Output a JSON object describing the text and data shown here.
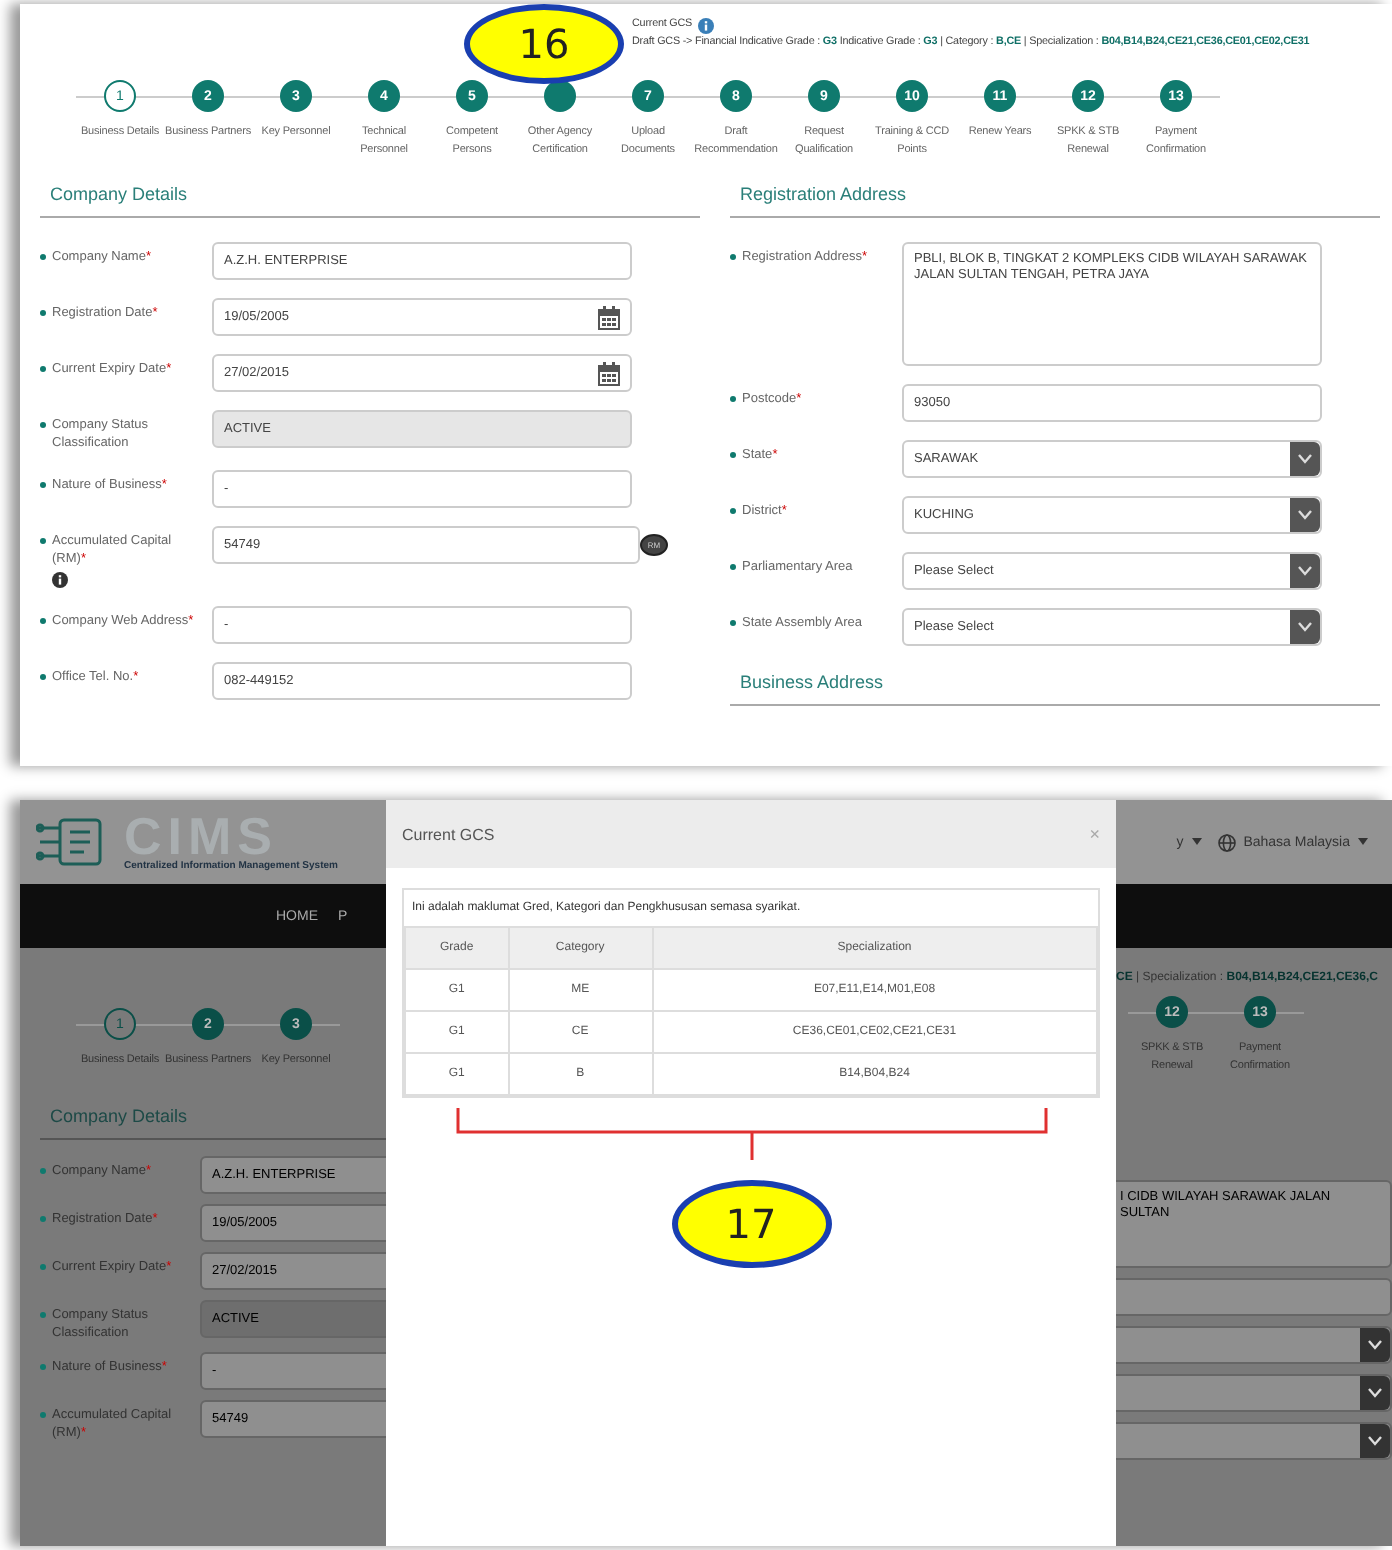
{
  "screen_1": {
    "gcs": {
      "title": "Current GCS",
      "draft_line": "Draft GCS -> Financial Indicative Grade : **G3**  Indicative Grade : **G3** | Category : **B,CE** | Specialization : **B04,B14,B24,CE21,CE36,CE01,CE02,CE31**"
    },
    "callout": "16",
    "steps": [
      {
        "number": "1",
        "label": "Business Details",
        "selected": true
      },
      {
        "number": "2",
        "label": "Business Partners",
        "selected": false
      },
      {
        "number": "3",
        "label": "Key Personnel",
        "selected": false
      },
      {
        "number": "4",
        "label": "Technical Personnel",
        "selected": false
      },
      {
        "number": "5",
        "label": "Competent Persons",
        "selected": false
      },
      {
        "label": "Other Agency Certification",
        "selected": false
      },
      {
        "number": "7",
        "label": "Upload Documents",
        "selected": false
      },
      {
        "number": "8",
        "label": "Draft Recommendation",
        "selected": false
      },
      {
        "number": "9",
        "label": "Request Qualification",
        "selected": false
      },
      {
        "number": "10",
        "label": "Training & CCD Points",
        "selected": false
      },
      {
        "number": "11",
        "label": "Renew Years",
        "selected": false
      },
      {
        "number": "12",
        "label": "SPKK & STB Renewal",
        "selected": false
      },
      {
        "number": "13",
        "label": "Payment Confirmation",
        "selected": false
      }
    ],
    "company_details": {
      "heading": "Company Details",
      "fields": [
        {
          "kind": "text",
          "label": "Company Name",
          "mark": "*",
          "value": "A.Z.H. ENTERPRISE"
        },
        {
          "kind": "date",
          "label": "Registration Date",
          "mark": "*",
          "value": "19/05/2005"
        },
        {
          "kind": "date",
          "label": "Current Expiry Date",
          "mark": "*",
          "value": "27/02/2015"
        },
        {
          "kind": "readonly",
          "label": "Company Status Classification",
          "value": "ACTIVE"
        },
        {
          "kind": "text",
          "label": "Nature of Business",
          "mark": "*",
          "value": "-"
        },
        {
          "kind": "currency",
          "label": "Accumulated Capital (RM)",
          "mark": "*",
          "value": "54749",
          "unit": "RM"
        },
        {
          "kind": "text",
          "label": "Company Web Address",
          "mark": "*",
          "value": "-"
        },
        {
          "kind": "text",
          "label": "Office Tel. No.",
          "mark": "*",
          "value": "082-449152"
        }
      ]
    },
    "registration_address": {
      "heading": "Registration Address",
      "fields": [
        {
          "kind": "textarea",
          "label": "Registration Address",
          "mark": "*",
          "value": "PBLI, BLOK B, TINGKAT 2 KOMPLEKS CIDB WILAYAH SARAWAK JALAN SULTAN TENGAH, PETRA JAYA"
        },
        {
          "kind": "text",
          "label": "Postcode",
          "mark": "*",
          "value": "93050"
        },
        {
          "kind": "select",
          "label": "State",
          "mark": "*",
          "value": "SARAWAK"
        },
        {
          "kind": "select",
          "label": "District",
          "mark": "*",
          "value": "KUCHING"
        },
        {
          "kind": "select",
          "label": "Parliamentary Area",
          "value": "Please Select"
        },
        {
          "kind": "select",
          "label": "State Assembly Area",
          "value": "Please Select"
        }
      ]
    },
    "business_address_heading": "Business Address"
  },
  "screen_2": {
    "header": {
      "brand": "CIMS",
      "subtitle": "Centralized Information Management System",
      "menu_fragment": "y",
      "language": "Bahasa Malaysia"
    },
    "nav": [
      "HOME",
      "P"
    ],
    "gcs_fragment": "**CE** | Specialization : **B04,B14,B24,CE21,CE36,C**",
    "steps_left": [
      {
        "number": "1",
        "label": "Business Details",
        "selected": true
      },
      {
        "number": "2",
        "label": "Business Partners",
        "selected": false
      },
      {
        "number": "3",
        "label": "Key Personnel",
        "selected": false
      }
    ],
    "steps_right": [
      {
        "number": "12",
        "label": "SPKK & STB Renewal",
        "selected": false
      },
      {
        "number": "13",
        "label": "Payment Confirmation",
        "selected": false
      }
    ],
    "company_details": {
      "heading": "Company Details",
      "fields": [
        {
          "kind": "text",
          "label": "Company Name",
          "mark": "*",
          "value": "A.Z.H. ENTERPRISE"
        },
        {
          "kind": "text",
          "label": "Registration Date",
          "mark": "*",
          "value": "19/05/2005"
        },
        {
          "kind": "text",
          "label": "Current Expiry Date",
          "mark": "*",
          "value": "27/02/2015"
        },
        {
          "kind": "readonly",
          "label": "Company Status Classification",
          "value": "ACTIVE"
        },
        {
          "kind": "text",
          "label": "Nature of Business",
          "mark": "*",
          "value": "-"
        },
        {
          "kind": "text",
          "label": "Accumulated Capital (RM)",
          "mark": "*",
          "value": "54749"
        }
      ]
    },
    "right_fields": [
      {
        "kind": "textarea",
        "value": "I CIDB WILAYAH SARAWAK JALAN SULTAN"
      },
      {
        "kind": "text"
      },
      {
        "kind": "select"
      },
      {
        "kind": "select"
      },
      {
        "kind": "select"
      }
    ],
    "modal": {
      "title": "Current GCS",
      "close": "×",
      "intro": "Ini adalah maklumat Gred, Kategori dan Pengkhususan semasa syarikat.",
      "columns": [
        "Grade",
        "Category",
        "Specialization"
      ],
      "rows": [
        [
          "G1",
          "ME",
          "E07,E11,E14,M01,E08"
        ],
        [
          "G1",
          "CE",
          "CE36,CE01,CE02,CE21,CE31"
        ],
        [
          "G1",
          "B",
          "B14,B04,B24"
        ]
      ],
      "callout": "17"
    }
  }
}
